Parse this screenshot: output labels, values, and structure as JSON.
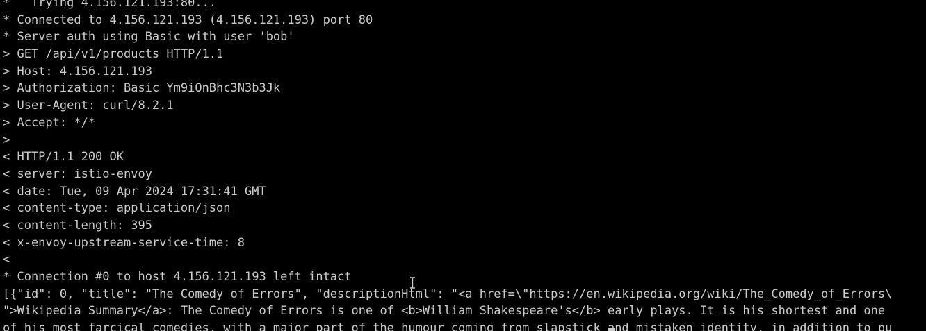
{
  "terminal": {
    "lines": [
      "*   Trying 4.156.121.193:80...",
      "* Connected to 4.156.121.193 (4.156.121.193) port 80",
      "* Server auth using Basic with user 'bob'",
      "> GET /api/v1/products HTTP/1.1",
      "> Host: 4.156.121.193",
      "> Authorization: Basic Ym9iOnBhc3N3b3Jk",
      "> User-Agent: curl/8.2.1",
      "> Accept: */*",
      ">",
      "< HTTP/1.1 200 OK",
      "< server: istio-envoy",
      "< date: Tue, 09 Apr 2024 17:31:41 GMT",
      "< content-type: application/json",
      "< content-length: 395",
      "< x-envoy-upstream-service-time: 8",
      "<",
      "* Connection #0 to host 4.156.121.193 left intact",
      "[{\"id\": 0, \"title\": \"The Comedy of Errors\", \"descriptionHtml\": \"<a href=\\\"https://en.wikipedia.org/wiki/The_Comedy_of_Errors\\",
      "\">Wikipedia Summary</a>: The Comedy of Errors is one of <b>William Shakespeare's</b> early plays. It is his shortest and one",
      "of his most farcical comedies, with a major part of the humour coming from slapstick and mistaken identity, in addition to pu"
    ]
  },
  "colors": {
    "background": "#000000",
    "foreground": "#cccccc"
  }
}
